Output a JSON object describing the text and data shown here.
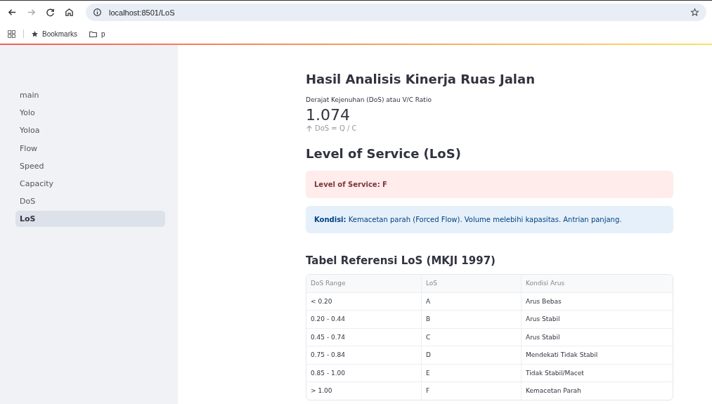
{
  "browser": {
    "url": "localhost:8501/LoS",
    "bookmarks": [
      {
        "kind": "star",
        "label": "Bookmarks"
      },
      {
        "kind": "folder",
        "label": "p"
      }
    ]
  },
  "sidebar": {
    "items": [
      {
        "label": "main",
        "selected": false
      },
      {
        "label": "Yolo",
        "selected": false
      },
      {
        "label": "Yoloa",
        "selected": false
      },
      {
        "label": "Flow",
        "selected": false
      },
      {
        "label": "Speed",
        "selected": false
      },
      {
        "label": "Capacity",
        "selected": false
      },
      {
        "label": "DoS",
        "selected": false
      },
      {
        "label": "LoS",
        "selected": true
      }
    ]
  },
  "title": "Hasil Analisis Kinerja Ruas Jalan",
  "metric": {
    "label": "Derajat Kejenuhan (DoS) atau V/C Ratio",
    "value": "1.074",
    "delta": "DoS = Q / C"
  },
  "los_heading": "Level of Service (LoS)",
  "alerts": [
    {
      "kind": "error",
      "text": "Level of Service: F"
    },
    {
      "kind": "info",
      "text": "**Kondisi:** Kemacetan parah (Forced Flow). Volume melebihi kapasitas. Antrian panjang."
    }
  ],
  "table": {
    "title": "Tabel Referensi LoS (MKJI 1997)",
    "columns": [
      "DoS Range",
      "LoS",
      "Kondisi Arus"
    ],
    "rows": [
      [
        "< 0.20",
        "A",
        "Arus Bebas"
      ],
      [
        "0.20 - 0.44",
        "B",
        "Arus Stabil"
      ],
      [
        "0.45 - 0.74",
        "C",
        "Arus Stabil"
      ],
      [
        "0.75 - 0.84",
        "D",
        "Mendekati Tidak Stabil"
      ],
      [
        "0.85 - 1.00",
        "E",
        "Tidak Stabil/Macet"
      ],
      [
        "> 1.00",
        "F",
        "Kemacetan Parah"
      ]
    ]
  }
}
